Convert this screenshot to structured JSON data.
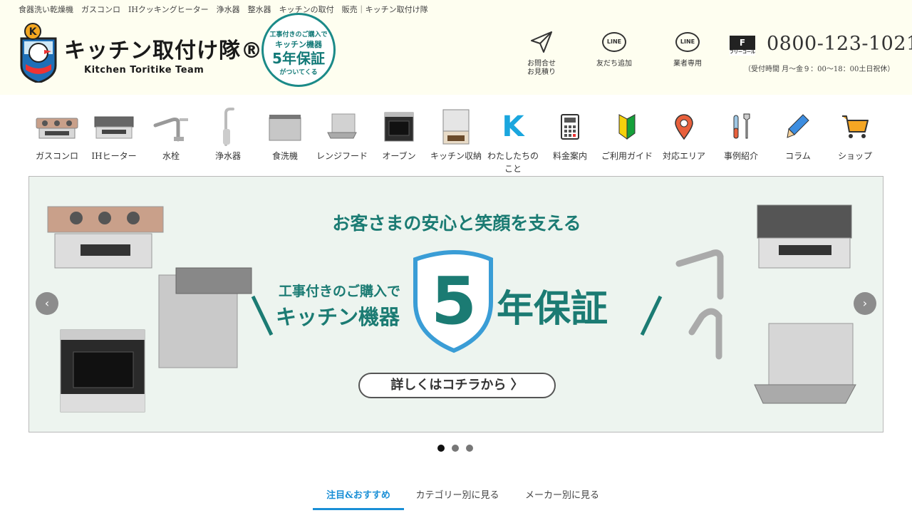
{
  "header": {
    "top_text": "食器洗い乾燥機　ガスコンロ　IHクッキングヒーター　浄水器　整水器　キッチンの取付　販売｜キッチン取付け隊",
    "logo_name": "キッチン取付け隊®",
    "logo_sub": "Kitchen Toritike Team",
    "logo_badge_letter": "K",
    "badge": {
      "line1": "工事付きのご購入で",
      "line2": "キッチン機器",
      "line3": "5年保証",
      "line4": "がついてくる"
    },
    "icons": [
      {
        "name": "send-icon",
        "label": "お問合せ\nお見積り"
      },
      {
        "name": "line-icon",
        "label": "友だち追加",
        "badge_text": "LINE"
      },
      {
        "name": "line-icon",
        "label": "業者専用",
        "badge_text": "LINE"
      }
    ],
    "freedial_mark": "F",
    "freedial_small": "フリーコール",
    "phone": "0800-123-1021",
    "hours": "（受付時間 月～金９：00～18：00土日祝休）"
  },
  "categories": [
    {
      "label": "ガスコンロ",
      "icon": "gas-stove-icon"
    },
    {
      "label": "IHヒーター",
      "icon": "ih-heater-icon"
    },
    {
      "label": "水栓",
      "icon": "faucet-icon"
    },
    {
      "label": "浄水器",
      "icon": "water-purifier-icon"
    },
    {
      "label": "食洗機",
      "icon": "dishwasher-icon"
    },
    {
      "label": "レンジフード",
      "icon": "range-hood-icon"
    },
    {
      "label": "オーブン",
      "icon": "oven-icon"
    },
    {
      "label": "キッチン収納",
      "icon": "kitchen-storage-icon"
    },
    {
      "label": "わたしたちのこと",
      "icon": "k-logo-icon",
      "glyph": "K"
    },
    {
      "label": "料金案内",
      "icon": "calculator-icon"
    },
    {
      "label": "ご利用ガイド",
      "icon": "beginner-mark-icon"
    },
    {
      "label": "対応エリア",
      "icon": "map-pin-icon"
    },
    {
      "label": "事例紹介",
      "icon": "tools-icon"
    },
    {
      "label": "コラム",
      "icon": "pencil-icon"
    },
    {
      "label": "ショップ",
      "icon": "cart-icon"
    }
  ],
  "slider": {
    "headline": "お客さまの安心と笑顔を支える",
    "left_line1": "工事付きのご購入で",
    "left_line2": "キッチン機器",
    "big_number": "5",
    "years": "年保証",
    "cta": "詳しくはコチラから 〉",
    "prev": "‹",
    "next": "›",
    "dots": 3,
    "active_dot": 0
  },
  "tabs": [
    {
      "label": "注目&おすすめ",
      "active": true
    },
    {
      "label": "カテゴリー別に見る",
      "active": false
    },
    {
      "label": "メーカー別に見る",
      "active": false
    }
  ],
  "colors": {
    "header_bg": "#fefef0",
    "accent_teal": "#1b7b73",
    "tab_blue": "#1a8fd6",
    "k_blue": "#1aa6de"
  }
}
